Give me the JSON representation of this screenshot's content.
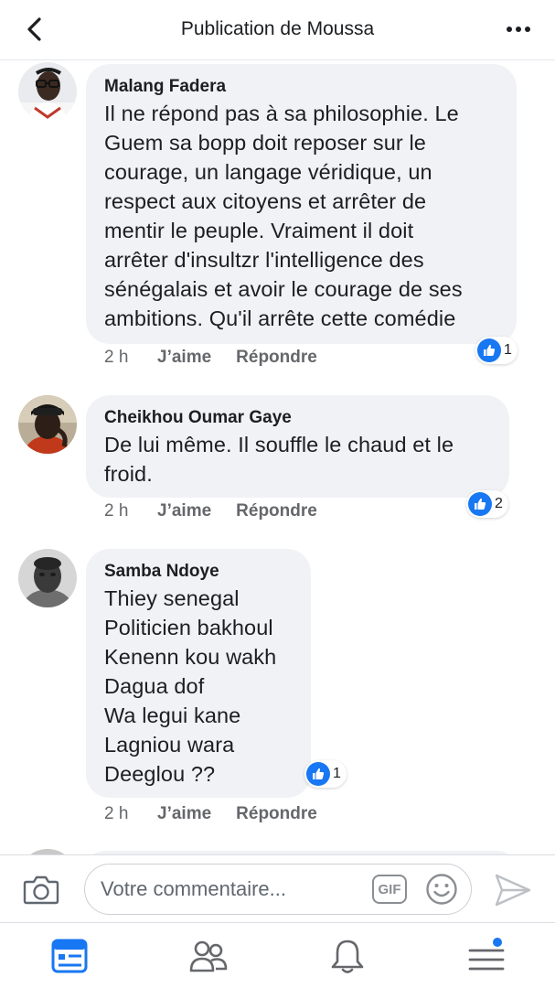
{
  "header": {
    "title": "Publication de Moussa",
    "back_icon": "chevron-left-icon",
    "more_icon": "more-horizontal-icon"
  },
  "comments": [
    {
      "author": "Malang Fadera",
      "text": "Il ne répond pas à sa philosophie. Le\nGuem sa bopp doit reposer sur le\ncourage, un langage véridique, un\nrespect aux citoyens et arrêter de\nmentir le peuple. Vraiment il doit\narrêter d'insultzr l'intelligence des\nsénégalais et avoir le courage de ses\nambitions. Qu'il arrête cette comédie",
      "time": "2 h",
      "like_label": "J’aime",
      "reply_label": "Répondre",
      "reaction_count": "1"
    },
    {
      "author": "Cheikhou Oumar Gaye",
      "text": "De lui même. Il souffle le chaud et le\nfroid.",
      "time": "2 h",
      "like_label": "J’aime",
      "reply_label": "Répondre",
      "reaction_count": "2"
    },
    {
      "author": "Samba Ndoye",
      "text": "Thiey senegal\nPoliticien bakhoul\nKenenn kou wakh\nDagua dof\nWa legui kane\nLagniou wara\nDeeglou ??",
      "time": "2 h",
      "like_label": "J’aime",
      "reply_label": "Répondre",
      "reaction_count": "1"
    }
  ],
  "composer": {
    "placeholder": "Votre commentaire...",
    "gif_label": "GIF",
    "camera_icon": "camera-icon",
    "emoji_icon": "emoji-icon",
    "send_icon": "send-icon"
  },
  "tabbar": {
    "tabs": [
      "news-feed-icon",
      "friends-icon",
      "notifications-icon",
      "menu-icon"
    ],
    "active_color": "#1877f2",
    "inactive_color": "#65676b"
  },
  "colors": {
    "accent": "#1877f2",
    "bubble": "#f0f2f5",
    "secondary_text": "#65676b"
  }
}
